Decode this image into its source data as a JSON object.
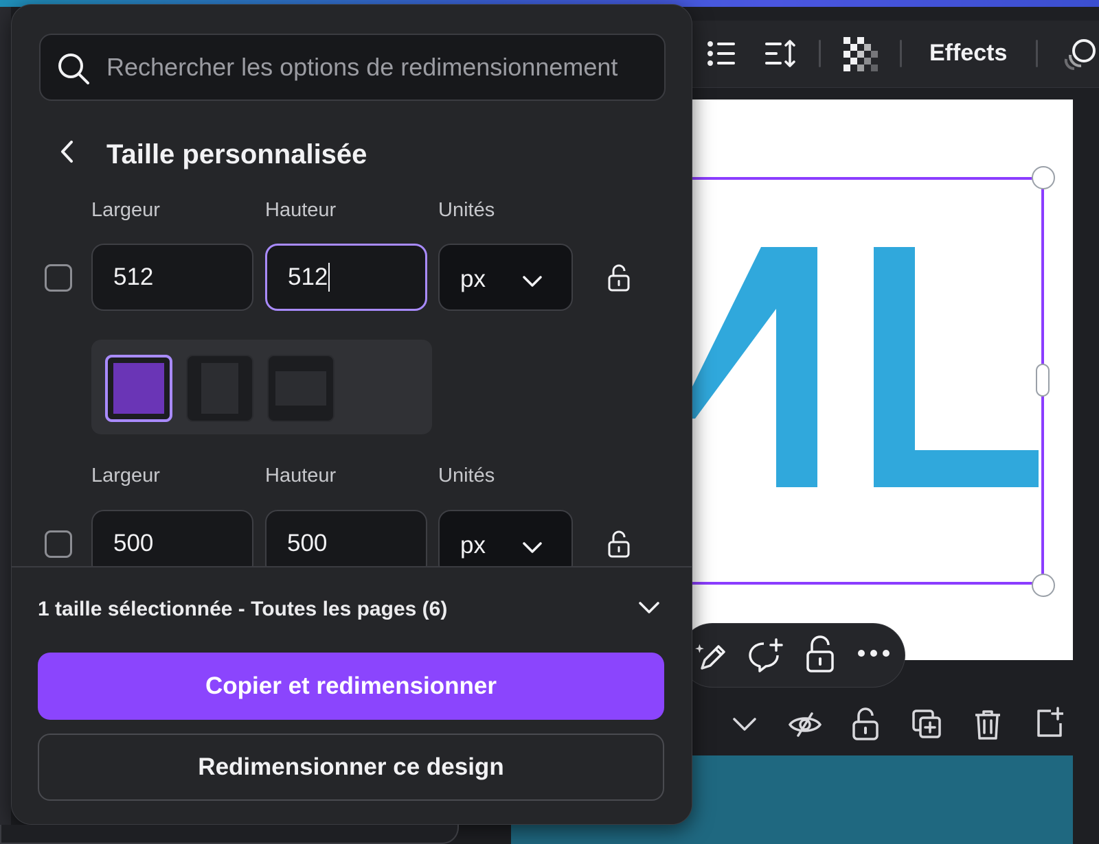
{
  "panel": {
    "search": {
      "placeholder": "Rechercher les options de redimensionnement",
      "value": ""
    },
    "title": "Taille personnalisée",
    "columns": {
      "width": "Largeur",
      "height": "Hauteur",
      "units": "Unités"
    },
    "rows": [
      {
        "width": "512",
        "height": "512",
        "unit": "px",
        "checked": false,
        "height_focused": true
      },
      {
        "width": "500",
        "height": "500",
        "unit": "px",
        "checked": false,
        "height_focused": false
      }
    ],
    "ratio_presets": [
      "square-icon",
      "portrait-icon",
      "landscape-icon"
    ],
    "selected_ratio": 0,
    "summary": "1 taille sélectionnée - Toutes les pages (6)",
    "primary_button": "Copier et redimensionner",
    "secondary_button": "Redimensionner ce design"
  },
  "editor": {
    "toolbar": {
      "effects_label": "Effects",
      "icons": [
        "list-icon",
        "line-spacing-icon",
        "transparency-icon",
        "effects-label",
        "animate-icon"
      ]
    },
    "canvas_text": "ML",
    "floating_toolbar_icons": [
      "magic-edit-icon",
      "comment-add-icon",
      "lock-icon",
      "more-icon"
    ],
    "page_actions_icons": [
      "chevron-down-icon",
      "hide-icon",
      "lock-icon",
      "duplicate-icon",
      "trash-icon",
      "add-page-icon"
    ]
  },
  "colors": {
    "accent": "#8b45fd",
    "accent_light": "#a98bff",
    "canvas_letter": "#30a8dc",
    "panel_bg": "#252629"
  }
}
